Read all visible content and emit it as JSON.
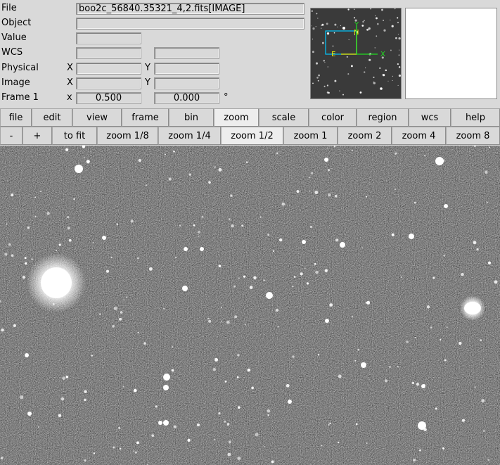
{
  "info": {
    "file_label": "File",
    "file_value": "boo2c_56840.35321_4,2.fits[IMAGE]",
    "object_label": "Object",
    "object_value": "",
    "value_label": "Value",
    "value_value": "",
    "wcs_label": "WCS",
    "wcs_value1": "",
    "wcs_value2": "",
    "physical_label": "Physical",
    "physical_x_label": "X",
    "physical_x_value": "",
    "physical_y_label": "Y",
    "physical_y_value": "",
    "image_label": "Image",
    "image_x_label": "X",
    "image_x_value": "",
    "image_y_label": "Y",
    "image_y_value": "",
    "frame_label": "Frame 1",
    "frame_x_label": "x",
    "frame_zoom_value": "0.500",
    "frame_angle_value": "0.000",
    "degree_symbol": "°"
  },
  "panner": {
    "compass_n": "N",
    "compass_e": "E",
    "axis_x": "X",
    "axis_y": "Y",
    "colors": {
      "compass": "#e8e800",
      "axes": "#22dd22",
      "bbox": "#00c8ff"
    }
  },
  "menubar": {
    "items": [
      "file",
      "edit",
      "view",
      "frame",
      "bin",
      "zoom",
      "scale",
      "color",
      "region",
      "wcs",
      "help"
    ],
    "active": "zoom"
  },
  "buttonbar": {
    "items": [
      "-",
      "+",
      "to fit",
      "zoom 1/8",
      "zoom 1/4",
      "zoom 1/2",
      "zoom 1",
      "zoom 2",
      "zoom 4",
      "zoom 8"
    ],
    "active": "zoom 1/2"
  }
}
